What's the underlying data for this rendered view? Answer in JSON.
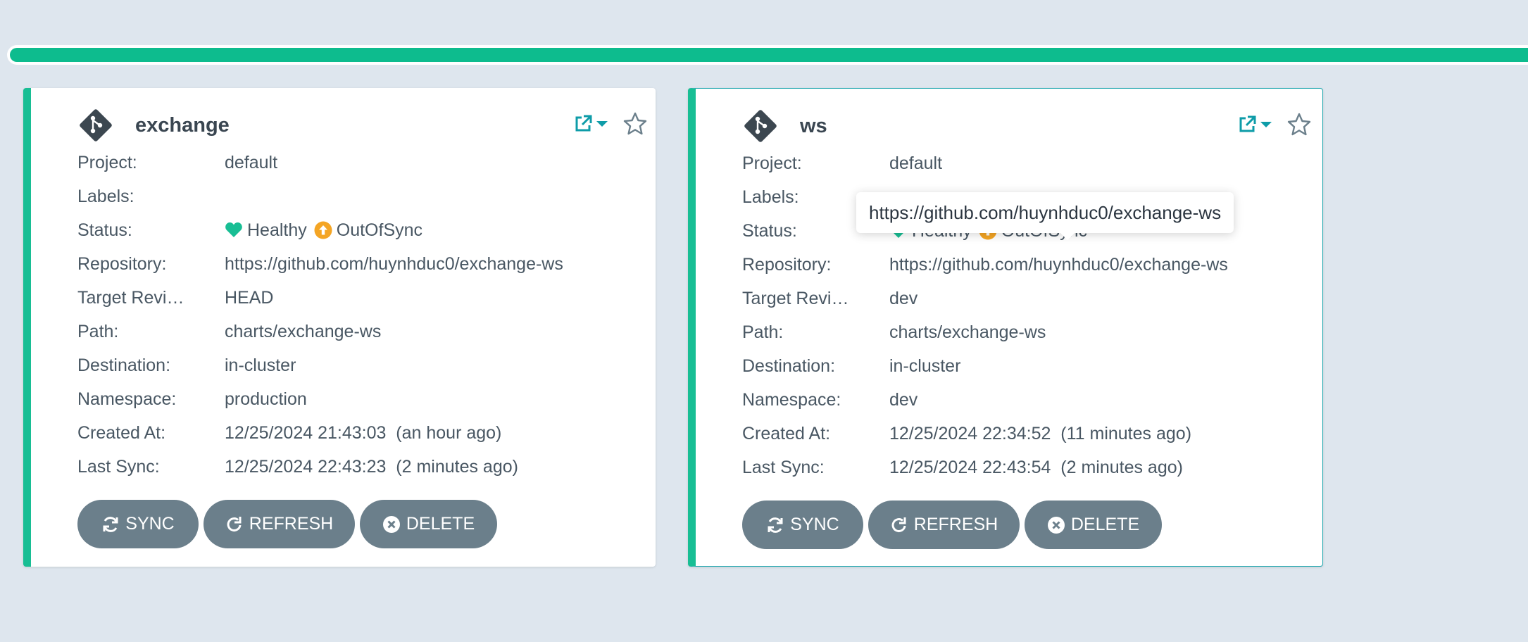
{
  "progress": {
    "percent": 100,
    "color": "#0dbc8e"
  },
  "colors": {
    "card_accent": "#18be94",
    "healthy": "#18be94",
    "out_of_sync": "#f4a524",
    "button_bg": "#6b7f8b",
    "link_teal": "#0e9ca8"
  },
  "labels": {
    "project": "Project:",
    "labels": "Labels:",
    "status": "Status:",
    "repository": "Repository:",
    "target_revision": "Target Revi…",
    "path": "Path:",
    "destination": "Destination:",
    "namespace": "Namespace:",
    "created_at": "Created At:",
    "last_sync": "Last Sync:"
  },
  "buttons": {
    "sync": "SYNC",
    "refresh": "REFRESH",
    "delete": "DELETE"
  },
  "apps": [
    {
      "name": "exchange",
      "project": "default",
      "labels": "",
      "health": "Healthy",
      "sync_status": "OutOfSync",
      "repository": "https://github.com/huynhduc0/exchange-ws",
      "target_revision": "HEAD",
      "path": "charts/exchange-ws",
      "destination": "in-cluster",
      "namespace": "production",
      "created_at": "12/25/2024 21:43:03  (an hour ago)",
      "last_sync": "12/25/2024 22:43:23  (2 minutes ago)"
    },
    {
      "name": "ws",
      "project": "default",
      "labels": "",
      "health": "Healthy",
      "sync_status": "OutOfSync",
      "repository": "https://github.com/huynhduc0/exchange-ws",
      "target_revision": "dev",
      "path": "charts/exchange-ws",
      "destination": "in-cluster",
      "namespace": "dev",
      "created_at": "12/25/2024 22:34:52  (11 minutes ago)",
      "last_sync": "12/25/2024 22:43:54  (2 minutes ago)"
    }
  ],
  "tooltip": {
    "text": "https://github.com/huynhduc0/exchange-ws"
  },
  "icons": {
    "app": "git-diamond-icon",
    "external": "external-link-icon",
    "caret": "caret-down-icon",
    "favorite": "star-outline-icon",
    "healthy": "heart-icon",
    "out_of_sync": "arrow-up-circle-icon",
    "sync": "sync-icon",
    "refresh": "redo-icon",
    "delete": "times-circle-icon"
  }
}
